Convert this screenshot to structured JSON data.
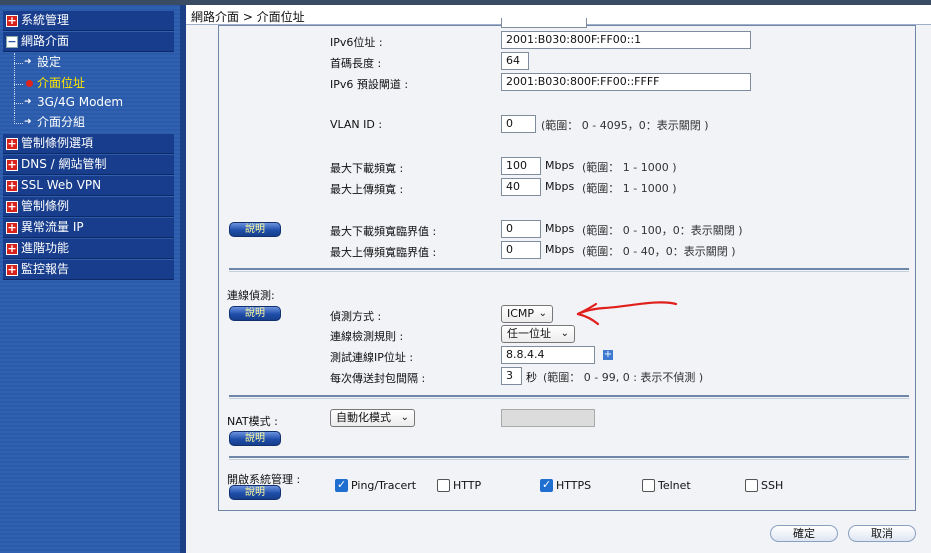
{
  "breadcrumb": "網路介面 > 介面位址",
  "sidebar": {
    "items": [
      {
        "label": "系統管理",
        "type": "group"
      },
      {
        "label": "網路介面",
        "type": "group-open"
      },
      {
        "label": "設定",
        "type": "sub"
      },
      {
        "label": "介面位址",
        "type": "sub-active"
      },
      {
        "label": "3G/4G Modem",
        "type": "sub"
      },
      {
        "label": "介面分組",
        "type": "sub"
      },
      {
        "label": "管制條例選項",
        "type": "group"
      },
      {
        "label": "DNS / 網站管制",
        "type": "group"
      },
      {
        "label": "SSL Web VPN",
        "type": "group"
      },
      {
        "label": "管制條例",
        "type": "group"
      },
      {
        "label": "異常流量 IP",
        "type": "group"
      },
      {
        "label": "進階功能",
        "type": "group"
      },
      {
        "label": "監控報告",
        "type": "group"
      }
    ]
  },
  "ipv6": {
    "addr_label": "IPv6位址 :",
    "addr_value": "2001:B030:800F:FF00::1",
    "prefix_label": "首碼長度 :",
    "prefix_value": "64",
    "gw_label": "IPv6 預設閘道 :",
    "gw_value": "2001:B030:800F:FF00::FFFF"
  },
  "vlan": {
    "label": "VLAN ID :",
    "value": "0",
    "hint": "(範圍： 0 - 4095，0：表示關閉 )"
  },
  "bandwidth": {
    "down_label": "最大下載頻寬 :",
    "down_value": "100",
    "down_unit": "Mbps",
    "down_hint": "(範圍： 1 - 1000 )",
    "up_label": "最大上傳頻寬 :",
    "up_value": "40",
    "up_unit": "Mbps",
    "up_hint": "(範圍： 1 - 1000 )",
    "down_th_label": "最大下載頻寬臨界值 :",
    "down_th_value": "0",
    "down_th_unit": "Mbps",
    "down_th_hint": "(範圍： 0 - 100，0：表示關閉 )",
    "up_th_label": "最大上傳頻寬臨界值 :",
    "up_th_value": "0",
    "up_th_unit": "Mbps",
    "up_th_hint": "(範圍： 0 - 40，0：表示關閉 )"
  },
  "help_label": "說明",
  "detect": {
    "section_label": "連線偵測:",
    "method_label": "偵測方式 :",
    "method_value": "ICMP",
    "rule_label": "連線檢測規則 :",
    "rule_value": "任一位址",
    "ip_label": "測試連線IP位址 :",
    "ip_value": "8.8.4.4",
    "interval_label": "每次傳送封包間隔 :",
    "interval_value": "3",
    "interval_unit": "秒",
    "interval_hint": "(範圍： 0 - 99, 0 : 表示不偵測 )"
  },
  "nat": {
    "label": "NAT模式 :",
    "value": "自動化模式"
  },
  "mgmt": {
    "label": "開啟系統管理 :",
    "options": [
      {
        "label": "Ping/Tracert",
        "checked": true
      },
      {
        "label": "HTTP",
        "checked": false
      },
      {
        "label": "HTTPS",
        "checked": true
      },
      {
        "label": "Telnet",
        "checked": false
      },
      {
        "label": "SSH",
        "checked": false
      }
    ]
  },
  "buttons": {
    "ok": "確定",
    "cancel": "取消"
  },
  "colors": {
    "sidebar_bg": "#2b5aa8",
    "menu_bg": "#173d8c",
    "active_text": "#ffe600",
    "annotation": "#e0201c"
  }
}
